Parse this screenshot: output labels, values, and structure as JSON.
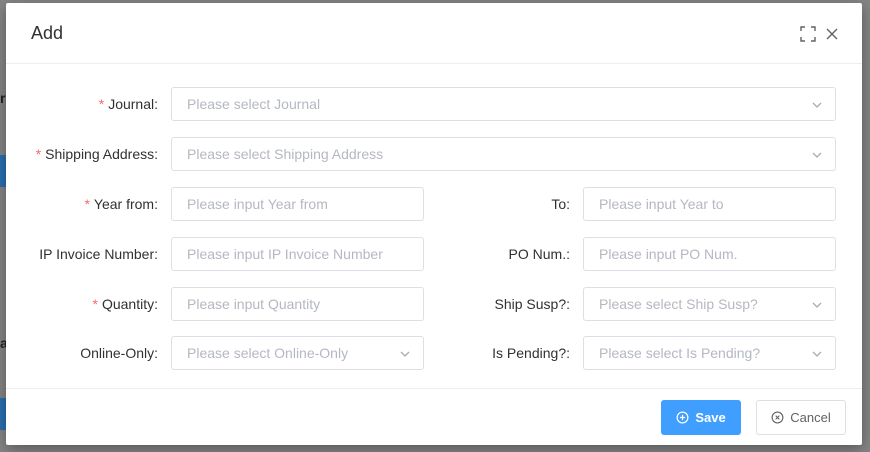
{
  "modal": {
    "title": "Add",
    "save_label": "Save",
    "cancel_label": "Cancel"
  },
  "background": {
    "fragment_1": "r",
    "fragment_2": "a"
  },
  "fields": {
    "journal": {
      "label": "Journal:",
      "required": "*",
      "value": "",
      "placeholder": "Please select Journal"
    },
    "shipping_address": {
      "label": "Shipping Address:",
      "required": "*",
      "value": "",
      "placeholder": "Please select Shipping Address"
    },
    "year_from": {
      "label": "Year from:",
      "required": "*",
      "value": "",
      "placeholder": "Please input Year from"
    },
    "year_to": {
      "label": "To:",
      "value": "",
      "placeholder": "Please input Year to"
    },
    "ip_invoice_number": {
      "label": "IP Invoice Number:",
      "value": "",
      "placeholder": "Please input IP Invoice Number"
    },
    "po_num": {
      "label": "PO Num.:",
      "value": "",
      "placeholder": "Please input PO Num."
    },
    "quantity": {
      "label": "Quantity:",
      "required": "*",
      "value": "",
      "placeholder": "Please input Quantity"
    },
    "ship_susp": {
      "label": "Ship Susp?:",
      "value": "",
      "placeholder": "Please select Ship Susp?"
    },
    "online_only": {
      "label": "Online-Only:",
      "value": "",
      "placeholder": "Please select Online-Only"
    },
    "is_pending": {
      "label": "Is Pending?:",
      "value": "",
      "placeholder": "Please select Is Pending?"
    }
  },
  "icons": {
    "fullscreen": "fullscreen-icon",
    "close": "close-icon",
    "chevron": "chevron-down-icon",
    "save": "plus-circle-icon",
    "cancel": "close-circle-icon"
  },
  "colors": {
    "primary": "#409eff",
    "required": "#f56c6c",
    "border": "#dcdfe6",
    "placeholder": "#b4b8c0",
    "text": "#303133"
  }
}
